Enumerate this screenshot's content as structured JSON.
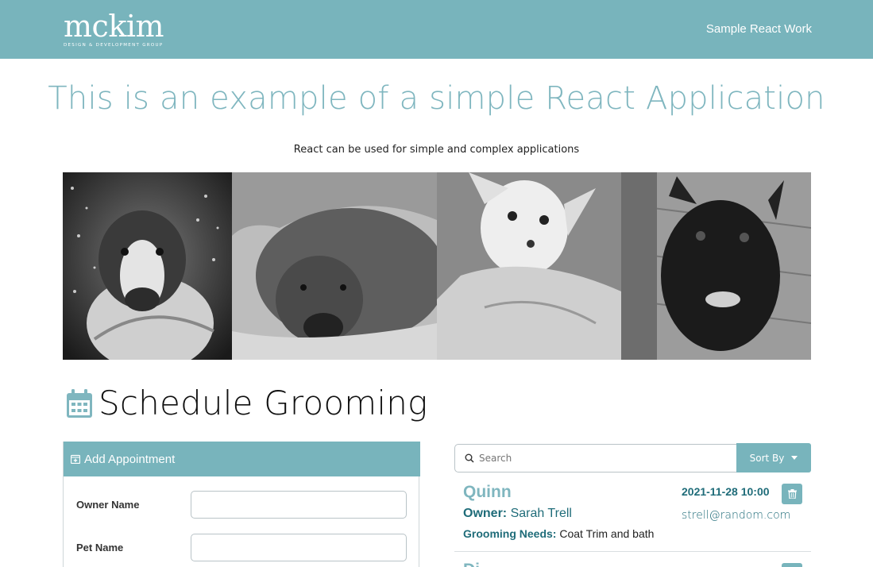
{
  "nav": {
    "logo_text": "mckim",
    "logo_subtext": "DESIGN & DEVELOPMENT GROUP",
    "link_label": "Sample React Work"
  },
  "hero": {
    "title": "This is an example of a simple React Application",
    "subtitle": "React can be used for simple and complex applications"
  },
  "photos": [
    {
      "name": "dog-photo-boxer",
      "icon": "photo-image"
    },
    {
      "name": "dog-photo-pitbull",
      "icon": "photo-image"
    },
    {
      "name": "dog-photo-chihuahua",
      "icon": "photo-image"
    },
    {
      "name": "dog-photo-french-bulldog",
      "icon": "photo-image"
    }
  ],
  "schedule": {
    "title": "Schedule Grooming",
    "icon": "calendar-icon"
  },
  "add_panel": {
    "header": "Add Appointment",
    "icon": "calendar-plus-icon",
    "fields": [
      {
        "label": "Owner Name",
        "value": "",
        "placeholder": ""
      },
      {
        "label": "Pet Name",
        "value": "",
        "placeholder": ""
      }
    ]
  },
  "search": {
    "placeholder": "Search",
    "value": "",
    "icon": "search-icon"
  },
  "sort": {
    "label": "Sort By",
    "icon": "caret-down-icon"
  },
  "appointments": [
    {
      "pet_name": "Quinn",
      "owner_label": "Owner:",
      "owner_name": "Sarah Trell",
      "needs_label": "Grooming Needs:",
      "needs": "Coat Trim and bath",
      "date": "2021-11-28 10:00",
      "email": "strell@random.com",
      "delete_icon": "trash-icon"
    },
    {
      "pet_name": "Di",
      "delete_icon": "trash-icon"
    }
  ],
  "colors": {
    "brand": "#78b4bc",
    "title_teal": "#7fb6bf",
    "dark_teal": "#1f6c79"
  }
}
